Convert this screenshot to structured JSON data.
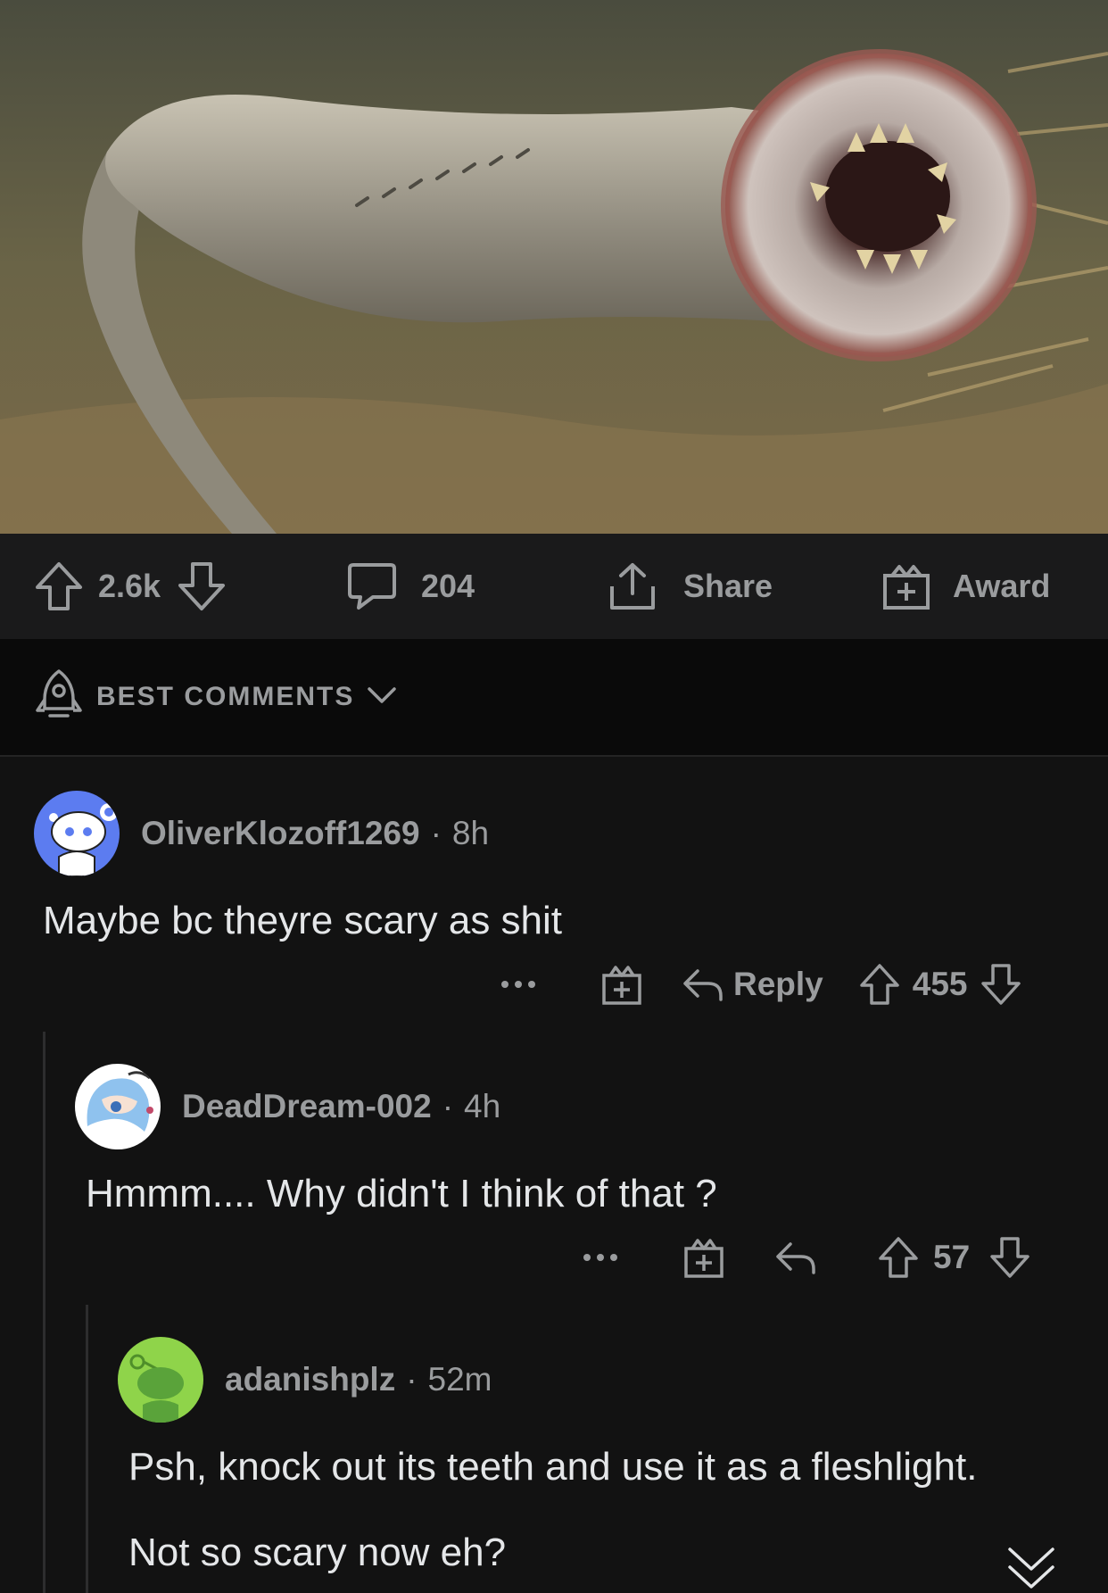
{
  "post": {
    "image_icon": "lamprey-photo",
    "upvotes": "2.6k",
    "comments_count": "204",
    "share_label": "Share",
    "award_label": "Award"
  },
  "sort": {
    "label": "BEST COMMENTS"
  },
  "comments": [
    {
      "user": "OliverKlozoff1269",
      "time": "8h",
      "body": "Maybe bc theyre scary as shit",
      "reply_label": "Reply",
      "score": "455",
      "avatar_color": "#5c7cf0"
    },
    {
      "user": "DeadDream-002",
      "time": "4h",
      "body": "Hmmm.... Why didn't I think of that ?",
      "score": "57",
      "avatar_color": "#ffffff"
    },
    {
      "user": "adanishplz",
      "time": "52m",
      "body_line1": "Psh, knock out its teeth and use it as a fleshlight.",
      "body_line2": "Not so scary now eh?",
      "avatar_color": "#8fd44a"
    }
  ],
  "colors": {
    "background": "#121212",
    "action_bar": "#1a1a1b",
    "sort_bar": "#0a0a0a",
    "muted_text": "#9a9c9e",
    "body_text": "#e4e6e8"
  }
}
